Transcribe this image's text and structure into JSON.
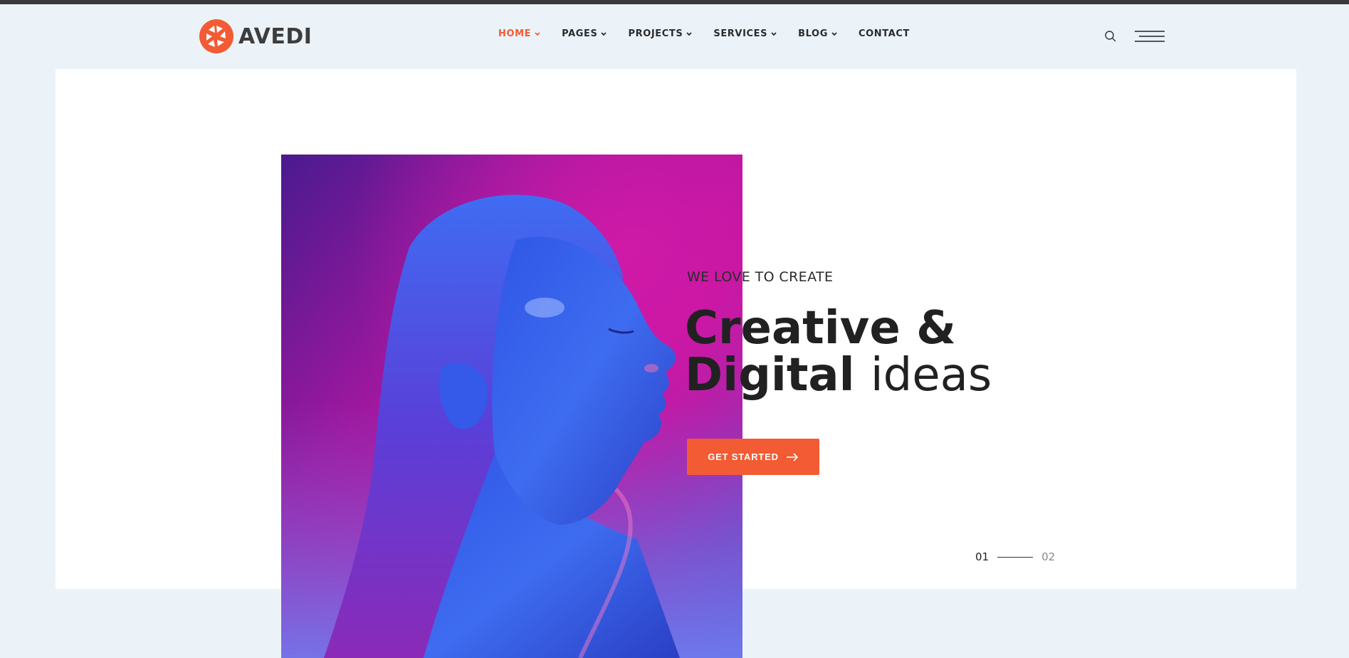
{
  "brand": {
    "name": "AVEDI",
    "color": "#f25b33"
  },
  "nav": {
    "items": [
      {
        "label": "HOME",
        "has_dropdown": true,
        "active": true
      },
      {
        "label": "PAGES",
        "has_dropdown": true,
        "active": false
      },
      {
        "label": "PROJECTS",
        "has_dropdown": true,
        "active": false
      },
      {
        "label": "SERVICES",
        "has_dropdown": true,
        "active": false
      },
      {
        "label": "BLOG",
        "has_dropdown": true,
        "active": false
      },
      {
        "label": "CONTACT",
        "has_dropdown": false,
        "active": false
      }
    ]
  },
  "header": {
    "search_icon": "search-icon",
    "menu_icon": "hamburger-menu-icon"
  },
  "hero": {
    "kicker": "WE LOVE TO CREATE",
    "headline_line1": "Creative &",
    "headline_line2_bold": "Digital",
    "headline_line2_light": "ideas",
    "cta_label": "GET STARTED",
    "cta_icon": "arrow-right-icon",
    "slide_current": "01",
    "slide_next": "02",
    "image_subject": "portrait in blue and magenta neon light"
  },
  "colors": {
    "accent": "#f25b33",
    "background": "#ebf3f9",
    "panel": "#ffffff",
    "text": "#212121"
  }
}
